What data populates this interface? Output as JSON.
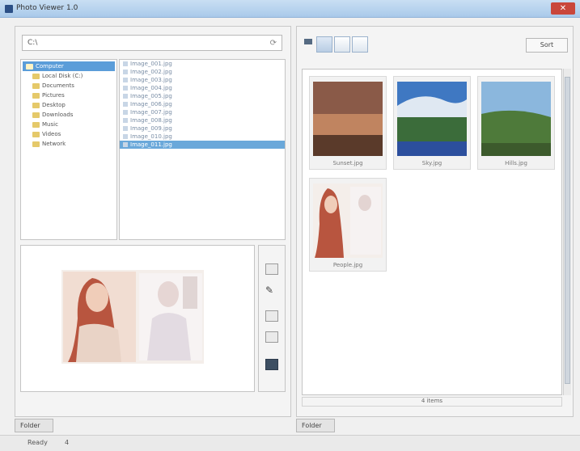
{
  "window": {
    "title": "Photo Viewer 1.0",
    "close_label": "✕"
  },
  "browser": {
    "path_placeholder": "",
    "path_value": "C:\\",
    "tree": [
      {
        "label": "Computer",
        "root": true
      },
      {
        "label": "Local Disk (C:)"
      },
      {
        "label": "Documents"
      },
      {
        "label": "Pictures"
      },
      {
        "label": "Desktop"
      },
      {
        "label": "Downloads"
      },
      {
        "label": "Music"
      },
      {
        "label": "Videos"
      },
      {
        "label": "Network"
      }
    ],
    "files": [
      {
        "label": "Image_001.jpg"
      },
      {
        "label": "Image_002.jpg"
      },
      {
        "label": "Image_003.jpg"
      },
      {
        "label": "Image_004.jpg"
      },
      {
        "label": "Image_005.jpg"
      },
      {
        "label": "Image_006.jpg"
      },
      {
        "label": "Image_007.jpg"
      },
      {
        "label": "Image_008.jpg"
      },
      {
        "label": "Image_009.jpg"
      },
      {
        "label": "Image_010.jpg"
      },
      {
        "label": "Image_011.jpg",
        "selected": true
      }
    ]
  },
  "left_tab": "Folder",
  "right_tab": "Folder",
  "sort_label": "Sort",
  "thumbnails": [
    {
      "caption": "Sunset.jpg"
    },
    {
      "caption": "Sky.jpg"
    },
    {
      "caption": "Hills.jpg"
    },
    {
      "caption": "People.jpg"
    }
  ],
  "status_text": "4 items",
  "footer": {
    "left": "Ready",
    "right": "4"
  },
  "colors": {
    "selection": "#5b9dd9",
    "titlebar": "#a9c9ea"
  }
}
